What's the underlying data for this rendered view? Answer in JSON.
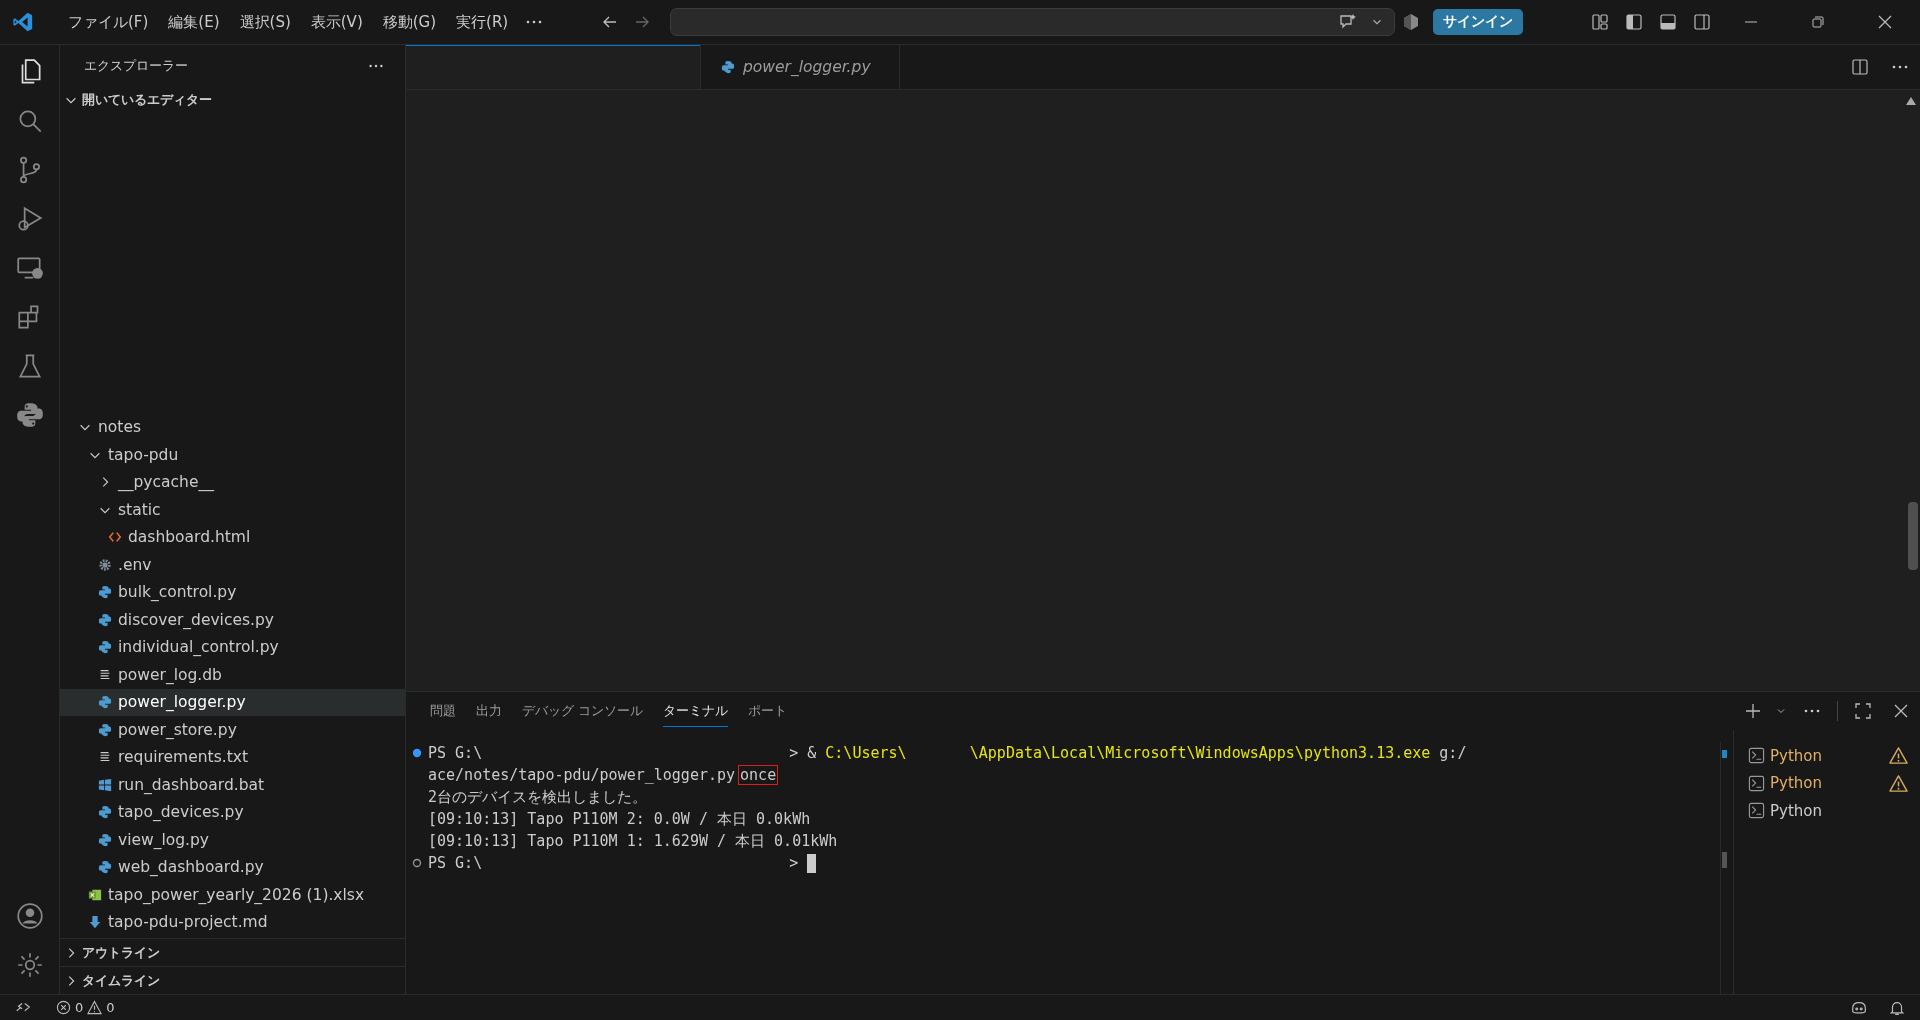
{
  "menu": [
    "ファイル(F)",
    "編集(E)",
    "選択(S)",
    "表示(V)",
    "移動(G)",
    "実行(R)"
  ],
  "sign_in": "サインイン",
  "sidebar": {
    "title": "エクスプローラー",
    "sections_top": [
      {
        "label": "開いているエディター",
        "expanded": true
      }
    ],
    "tree": [
      {
        "label": "notes",
        "kind": "folder",
        "expanded": true,
        "selected": false,
        "children": [
          {
            "label": "tapo-pdu",
            "kind": "folder",
            "expanded": true,
            "selected": false,
            "children": [
              {
                "label": "__pycache__",
                "kind": "folder",
                "expanded": false,
                "selected": false
              },
              {
                "label": "static",
                "kind": "folder",
                "expanded": true,
                "selected": false,
                "children": [
                  {
                    "label": "dashboard.html",
                    "kind": "html",
                    "selected": false
                  }
                ]
              },
              {
                "label": ".env",
                "kind": "gear",
                "selected": false
              },
              {
                "label": "bulk_control.py",
                "kind": "python",
                "selected": false
              },
              {
                "label": "discover_devices.py",
                "kind": "python",
                "selected": false
              },
              {
                "label": "individual_control.py",
                "kind": "python",
                "selected": false
              },
              {
                "label": "power_log.db",
                "kind": "text",
                "selected": false
              },
              {
                "label": "power_logger.py",
                "kind": "python",
                "selected": true
              },
              {
                "label": "power_store.py",
                "kind": "python",
                "selected": false
              },
              {
                "label": "requirements.txt",
                "kind": "text",
                "selected": false
              },
              {
                "label": "run_dashboard.bat",
                "kind": "windows",
                "selected": false
              },
              {
                "label": "tapo_devices.py",
                "kind": "python",
                "selected": false
              },
              {
                "label": "view_log.py",
                "kind": "python",
                "selected": false
              },
              {
                "label": "web_dashboard.py",
                "kind": "python",
                "selected": false
              }
            ]
          },
          {
            "label": "tapo_power_yearly_2026 (1).xlsx",
            "kind": "excel",
            "selected": false
          },
          {
            "label": "tapo-pdu-project.md",
            "kind": "markdown",
            "selected": false
          }
        ]
      }
    ],
    "sections_bottom": [
      {
        "label": "アウトライン",
        "expanded": false
      },
      {
        "label": "タイムライン",
        "expanded": false
      }
    ]
  },
  "editor_tabs": [
    {
      "label": "power_logger.py",
      "selected": false
    }
  ],
  "panel": {
    "tabs": [
      {
        "label": "問題",
        "selected": false
      },
      {
        "label": "出力",
        "selected": false
      },
      {
        "label": "デバッグ コンソール",
        "selected": false
      },
      {
        "label": "ターミナル",
        "selected": true
      },
      {
        "label": "ポート",
        "selected": false
      }
    ],
    "terminal_lines": [
      {
        "prompt": true,
        "running": false,
        "segments": [
          {
            "text": "PS G:\\",
            "kind": "plain"
          },
          {
            "text": "                                 > &",
            "kind": "plain"
          },
          {
            "text": "C:\\Users\\",
            "kind": "path"
          },
          {
            "text": "      \\AppData\\Local\\Microsoft\\WindowsApps\\python3.13.exe",
            "kind": "path"
          },
          {
            "text": "g:/",
            "kind": "plain"
          }
        ]
      },
      {
        "segments": [
          {
            "text": "ace/notes/tapo-pdu/power_logger.py",
            "kind": "plain"
          },
          {
            "text": "once",
            "kind": "boxed"
          }
        ]
      },
      {
        "segments": [
          {
            "text": "2台のデバイスを検出しました。",
            "kind": "plain"
          }
        ]
      },
      {
        "segments": [
          {
            "text": "[09:10:13] Tapo P110M 2: 0.0W / 本日 0.0kWh",
            "kind": "plain"
          }
        ]
      },
      {
        "segments": [
          {
            "text": "[09:10:13] Tapo P110M 1: 1.629W / 本日 0.01kWh",
            "kind": "plain"
          }
        ]
      },
      {
        "prompt": true,
        "running": true,
        "cursor": true,
        "segments": [
          {
            "text": "PS G:\\",
            "kind": "plain"
          },
          {
            "text": "                                 >",
            "kind": "plain"
          }
        ]
      }
    ],
    "terminals": [
      {
        "label": "Python",
        "warning": true
      },
      {
        "label": "Python",
        "warning": true
      },
      {
        "label": "Python",
        "warning": false
      }
    ]
  },
  "status_bar": {
    "errors": "0",
    "warnings": "0"
  }
}
